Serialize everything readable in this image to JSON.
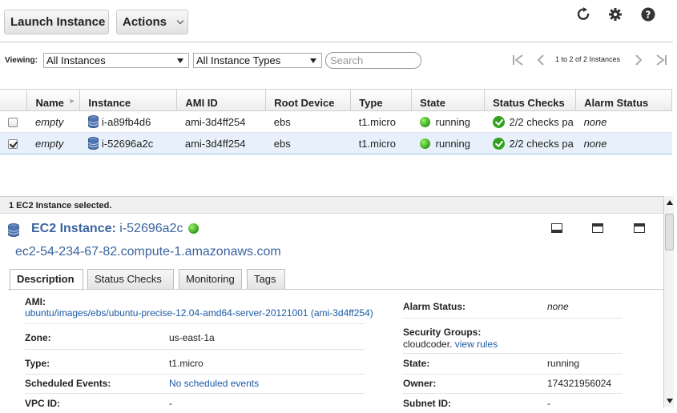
{
  "toolbar": {
    "launch_label": "Launch Instance",
    "actions_label": "Actions"
  },
  "top_icons": [
    "refresh-icon",
    "gear-icon",
    "help-icon"
  ],
  "filter": {
    "viewing_label": "Viewing:",
    "instances_select": "All Instances",
    "types_select": "All Instance Types",
    "search_placeholder": "Search"
  },
  "pager": {
    "text": "1 to 2 of 2 Instances"
  },
  "table": {
    "headers": [
      "Name",
      "Instance",
      "AMI ID",
      "Root Device",
      "Type",
      "State",
      "Status Checks",
      "Alarm Status"
    ],
    "rows": [
      {
        "name": "empty",
        "instance": "i-a89fb4d6",
        "ami": "ami-3d4ff254",
        "root": "ebs",
        "type": "t1.micro",
        "state": "running",
        "checks": "2/2 checks pa",
        "alarm": "none",
        "checked": false
      },
      {
        "name": "empty",
        "instance": "i-52696a2c",
        "ami": "ami-3d4ff254",
        "root": "ebs",
        "type": "t1.micro",
        "state": "running",
        "checks": "2/2 checks pa",
        "alarm": "none",
        "checked": true
      }
    ]
  },
  "details": {
    "selected_text": "1 EC2 Instance selected.",
    "title_prefix": "EC2 Instance:",
    "title_id": "i-52696a2c",
    "dns": "ec2-54-234-67-82.compute-1.amazonaws.com",
    "tabs": [
      "Description",
      "Status Checks",
      "Monitoring",
      "Tags"
    ],
    "fields": {
      "ami_label": "AMI:",
      "ami_value": "ubuntu/images/ebs/ubuntu-precise-12.04-amd64-server-20121001 (ami-3d4ff254)",
      "zone_label": "Zone:",
      "zone_value": "us-east-1a",
      "type_label": "Type:",
      "type_value": "t1.micro",
      "scheduled_label": "Scheduled Events:",
      "scheduled_value": "No scheduled events",
      "vpc_label": "VPC ID:",
      "vpc_value": "-",
      "alarm_label": "Alarm Status:",
      "alarm_value": "none",
      "security_label": "Security Groups:",
      "security_value": "cloudcoder.",
      "security_link": "view rules",
      "state_label": "State:",
      "state_value": "running",
      "owner_label": "Owner:",
      "owner_value": "174321956024",
      "subnet_label": "Subnet ID:",
      "subnet_value": "-"
    }
  },
  "colors": {
    "link": "#1a5aa6",
    "running_green": "#2f9e1a",
    "selected_row": "#e8f1fb"
  }
}
